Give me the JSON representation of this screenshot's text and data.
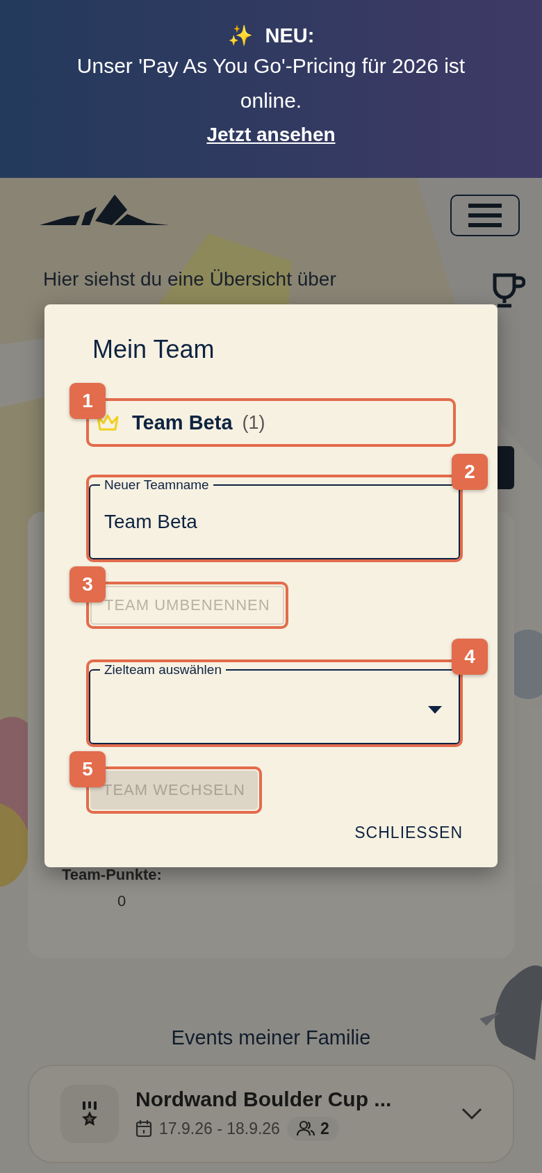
{
  "banner": {
    "icon": "✨",
    "title": "NEU:",
    "message": "Unser 'Pay As You Go'-Pricing für 2026 ist online.",
    "link": "Jetzt ansehen"
  },
  "page": {
    "intro": "Hier siehst du eine Übersicht über",
    "team_points_label": "Team-Punkte:",
    "team_points": "0",
    "events_heading": "Events meiner Familie",
    "events": [
      {
        "title": "Nordwand Boulder Cup ...",
        "dates": "17.9.26 - 18.9.26",
        "participants": "2",
        "expanded": false
      }
    ]
  },
  "dialog": {
    "title": "Mein Team",
    "current_team": {
      "name": "Team Beta",
      "count": "(1)",
      "captain": true,
      "marker": "1"
    },
    "rename_field": {
      "label": "Neuer Teamname",
      "value": "Team Beta",
      "marker": "2"
    },
    "rename_button": {
      "label": "TEAM UMBENENNEN",
      "disabled": true,
      "marker": "3"
    },
    "target_select": {
      "label": "Zielteam auswählen",
      "marker": "4"
    },
    "switch_button": {
      "label": "TEAM WECHSELN",
      "disabled": true,
      "marker": "5"
    },
    "close_button": "SCHLIESSEN"
  }
}
